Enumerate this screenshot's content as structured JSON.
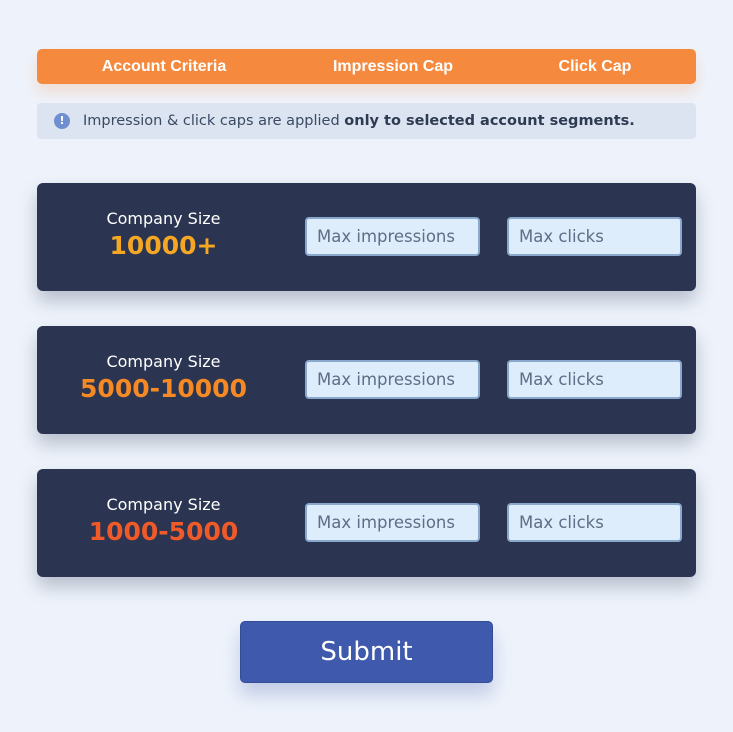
{
  "header": {
    "columns": [
      "Account Criteria",
      "Impression Cap",
      "Click Cap"
    ],
    "color": "#f58a3f"
  },
  "notice": {
    "icon": "info-icon",
    "icon_glyph": "!",
    "text_prefix": "Impression & click caps are applied ",
    "text_bold": "only to selected account segments."
  },
  "rows": [
    {
      "criterion_label": "Company Size",
      "criterion_value": "10000+",
      "value_color": "#f5a623",
      "impressions_placeholder": "Max impressions",
      "impressions_value": "",
      "clicks_placeholder": "Max clicks",
      "clicks_value": ""
    },
    {
      "criterion_label": "Company Size",
      "criterion_value": "5000-10000",
      "value_color": "#f58a24",
      "impressions_placeholder": "Max impressions",
      "impressions_value": "",
      "clicks_placeholder": "Max clicks",
      "clicks_value": ""
    },
    {
      "criterion_label": "Company Size",
      "criterion_value": "1000-5000",
      "value_color": "#f05a28",
      "impressions_placeholder": "Max impressions",
      "impressions_value": "",
      "clicks_placeholder": "Max clicks",
      "clicks_value": ""
    }
  ],
  "submit": {
    "label": "Submit"
  }
}
